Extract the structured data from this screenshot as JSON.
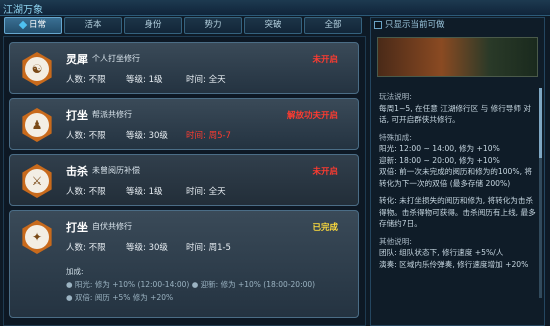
{
  "window": {
    "title": "江湖万象"
  },
  "tabs": [
    {
      "label": "日常",
      "active": true
    },
    {
      "label": "活本",
      "active": false
    },
    {
      "label": "身份",
      "active": false
    },
    {
      "label": "势力",
      "active": false
    },
    {
      "label": "突破",
      "active": false
    },
    {
      "label": "全部",
      "active": false
    }
  ],
  "cards": [
    {
      "icon": "meditation-icon",
      "name": "灵犀",
      "desc": "个人打坐修行",
      "status": "未开启",
      "status_color": "#ff3b30",
      "people": "人数:  不限",
      "level": "等级:  1级",
      "time": "时间:  全天"
    },
    {
      "icon": "practice-icon",
      "name": "打坐",
      "desc": "帮派共修行",
      "status": "解放功夫开启",
      "status_color": "#ff3b30",
      "people": "人数:  不限",
      "level": "等级:  30级",
      "time": "时间:  周5-7"
    },
    {
      "icon": "sword-icon",
      "name": "击杀",
      "desc": "未曾阅历补偿",
      "status": "未开启",
      "status_color": "#ff3b30",
      "people": "人数:  不限",
      "level": "等级:  1级",
      "time": "时间:  全天"
    },
    {
      "icon": "team-icon",
      "name": "打坐",
      "desc": "自伏共修行",
      "status": "已完成",
      "status_color": "#ffdc3c",
      "people": "人数:  不限",
      "level": "等级:  30级",
      "time": "时间:  周1-5",
      "bonus_title": "加成:",
      "bonus_lines": [
        "● 阳光: 修为 +10% (12:00-14:00)     ● 迎新: 修为 +10% (18:00-20:00)",
        "● 双倍: 阅历 +5% 修为 +20%"
      ]
    }
  ],
  "right": {
    "checkbox_label": "只显示当前可做",
    "sections": [
      {
        "title": "玩法说明:",
        "lines": [
          "每周1~5, 在任意 江湖修行区 与 修行导师 对话, 可开启群侠共修行。"
        ]
      },
      {
        "title": "特殊加成:",
        "lines": [
          "阳光: 12:00 ~ 14:00, 修为 +10%",
          "迎新: 18:00 ~ 20:00, 修为 +10%",
          "双倍: 前一次未完成的阅历和修为的100%, 将转化为下一次的双倍 (最多存储 200%)"
        ]
      },
      {
        "title": "",
        "lines": [
          "转化: 未打坐损失的阅历和修为, 将转化为击杀得物。击杀得物可获得。击杀阅历有上线, 最多存储约7日。"
        ]
      },
      {
        "title": "其他说明:",
        "lines": [
          "团队: 组队状态下, 修行速度 +5%/人",
          "演奏: 区域内乐伶弹奏, 修行速度增加 +20%"
        ]
      }
    ]
  }
}
